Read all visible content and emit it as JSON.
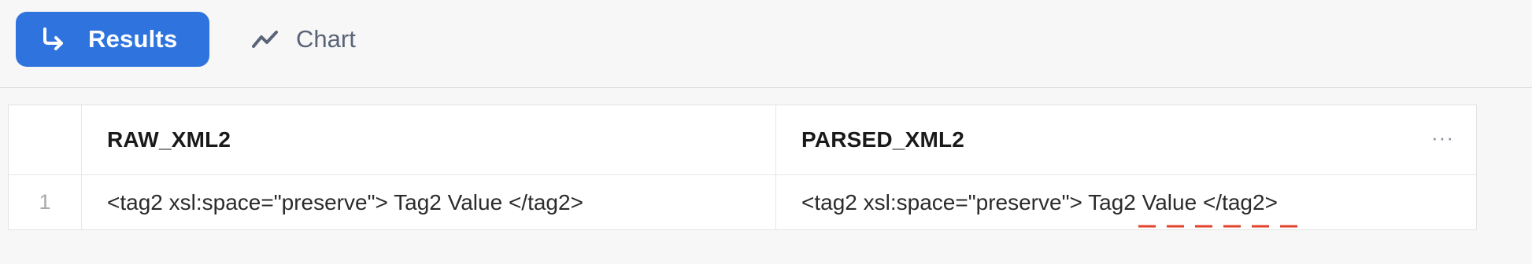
{
  "toolbar": {
    "results_label": "Results",
    "chart_label": "Chart"
  },
  "grid": {
    "columns": [
      "RAW_XML2",
      "PARSED_XML2"
    ],
    "rows": [
      {
        "index": "1",
        "raw_xml2": "<tag2 xsl:space=\"preserve\"> Tag2 Value </tag2>",
        "parsed_xml2": "<tag2 xsl:space=\"preserve\"> Tag2 Value </tag2>"
      }
    ],
    "more_label": "···"
  },
  "colors": {
    "accent": "#2f74de",
    "spellcheck": "#e0412a"
  },
  "icons": {
    "results": "return-arrow-icon",
    "chart": "trend-line-icon",
    "more": "more-horizontal-icon"
  }
}
